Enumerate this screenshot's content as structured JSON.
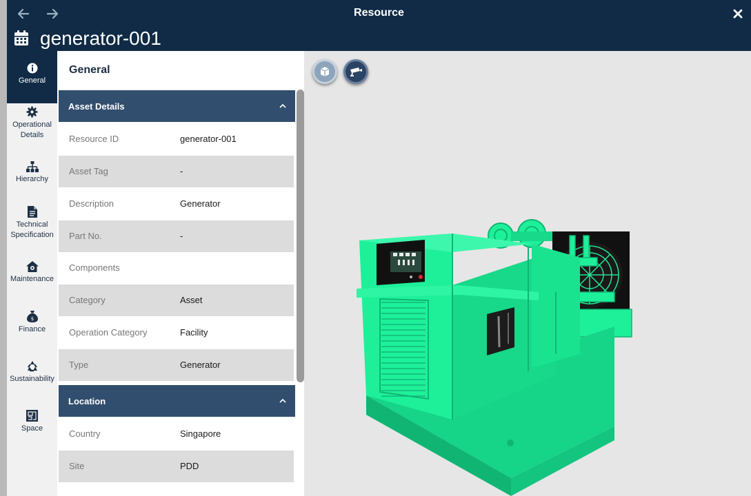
{
  "window": {
    "title": "Resource",
    "resource_name": "generator-001"
  },
  "sidebar": {
    "items": [
      {
        "label": "General",
        "icon": "info-icon",
        "active": true
      },
      {
        "label": "Operational Details",
        "icon": "gear-icon"
      },
      {
        "label": "Hierarchy",
        "icon": "hierarchy-icon"
      },
      {
        "label": "Technical Specification",
        "icon": "document-icon"
      },
      {
        "label": "Maintenance",
        "icon": "house-gear-icon"
      },
      {
        "label": "Finance",
        "icon": "money-bag-icon"
      },
      {
        "label": "Sustainability",
        "icon": "recycle-icon"
      },
      {
        "label": "Space",
        "icon": "floorplan-icon"
      }
    ]
  },
  "panel": {
    "title": "General",
    "sections": [
      {
        "title": "Asset Details",
        "rows": [
          {
            "label": "Resource ID",
            "value": "generator-001"
          },
          {
            "label": "Asset Tag",
            "value": "-"
          },
          {
            "label": "Description",
            "value": "Generator"
          },
          {
            "label": "Part No.",
            "value": "-"
          },
          {
            "label": "Components",
            "value": ""
          },
          {
            "label": "Category",
            "value": "Asset"
          },
          {
            "label": "Operation Category",
            "value": "Facility"
          },
          {
            "label": "Type",
            "value": "Generator"
          }
        ]
      },
      {
        "title": "Location",
        "rows": [
          {
            "label": "Country",
            "value": "Singapore"
          },
          {
            "label": "Site",
            "value": "PDD"
          }
        ]
      }
    ]
  },
  "viewer": {
    "buttons": [
      {
        "name": "3d-view",
        "icon": "cube-icon"
      },
      {
        "name": "camera-view",
        "icon": "camera-icon"
      }
    ],
    "model_color": "#1ef09a"
  },
  "colors": {
    "header": "#112b46",
    "section_header": "#324e6e",
    "viewer_bg": "#e6e6e6"
  }
}
